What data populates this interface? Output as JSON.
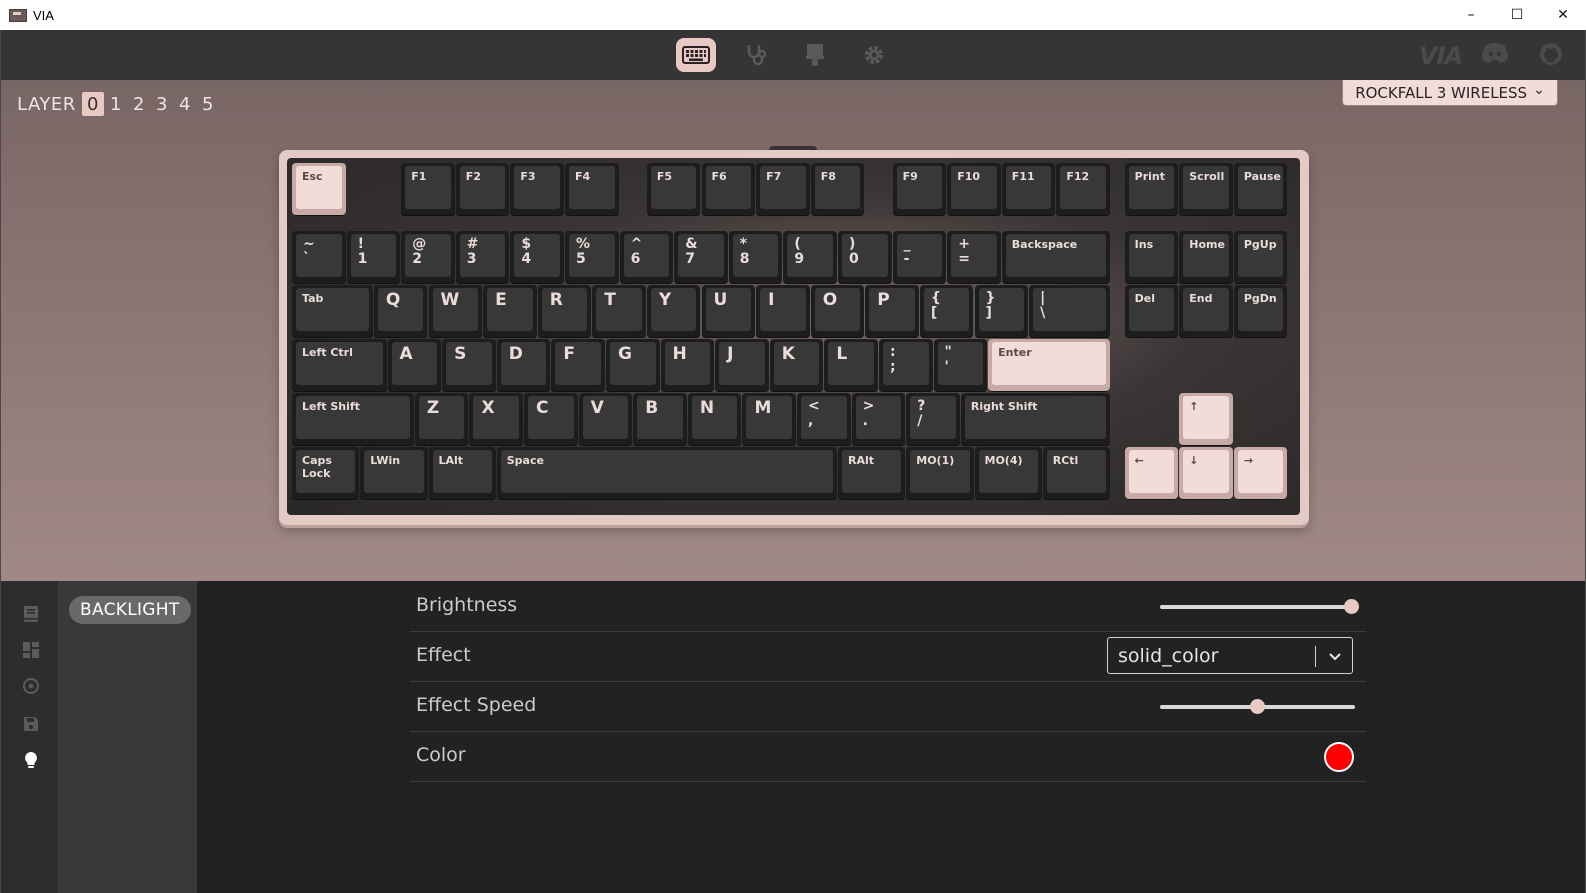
{
  "window": {
    "title": "VIA",
    "controls": [
      "–",
      "☐",
      "✕"
    ]
  },
  "nav": {
    "tabs": [
      {
        "id": "configure",
        "icon": "keyboard-icon",
        "active": true
      },
      {
        "id": "test",
        "icon": "stethoscope-icon",
        "active": false
      },
      {
        "id": "design",
        "icon": "brush-icon",
        "active": false
      },
      {
        "id": "settings",
        "icon": "gear-icon",
        "active": false
      }
    ],
    "right_icons": [
      "via-logo-icon",
      "discord-icon",
      "github-icon"
    ],
    "via_logo_text": "VIA"
  },
  "layers": {
    "label": "LAYER",
    "items": [
      "0",
      "1",
      "2",
      "3",
      "4",
      "5"
    ],
    "active": "0"
  },
  "device": {
    "name": "ROCKFALL 3 WIRELESS",
    "chevron": "⌄"
  },
  "keyboard": {
    "keys": [
      "Esc",
      "F1",
      "F2",
      "F3",
      "F4",
      "F5",
      "F6",
      "F7",
      "F8",
      "F9",
      "F10",
      "F11",
      "F12",
      "Print",
      "Scroll",
      "Pause",
      "~\n`",
      "!\n1",
      "@\n2",
      "#\n3",
      "$\n4",
      "%\n5",
      "^\n6",
      "&\n7",
      "*\n8",
      "(\n9",
      ")\n0",
      "_\n-",
      "+\n=",
      "Backspace",
      "Ins",
      "Home",
      "PgUp",
      "Tab",
      "Q",
      "W",
      "E",
      "R",
      "T",
      "Y",
      "U",
      "I",
      "O",
      "P",
      "{\n[",
      "}\n]",
      "|\n\\",
      "Del",
      "End",
      "PgDn",
      "Left Ctrl",
      "A",
      "S",
      "D",
      "F",
      "G",
      "H",
      "J",
      "K",
      "L",
      ":\n;",
      "\"\n'",
      "Enter",
      "Left Shift",
      "Z",
      "X",
      "C",
      "V",
      "B",
      "N",
      "M",
      "<\n,",
      ">\n.",
      "?\n/",
      "Right Shift",
      "↑",
      "Caps Lock",
      "LWin",
      "LAlt",
      "Space",
      "RAlt",
      "MO(1)",
      "MO(4)",
      "RCtl",
      "←",
      "↓",
      "→"
    ]
  },
  "sidebar": {
    "icons": [
      "book-icon",
      "layout-icon",
      "target-icon",
      "save-icon",
      "lightbulb-icon"
    ],
    "active": "lightbulb-icon"
  },
  "menu": {
    "active_item": "BACKLIGHT"
  },
  "backlight": {
    "brightness": {
      "label": "Brightness",
      "value_fraction": 1.0
    },
    "effect": {
      "label": "Effect",
      "value": "solid_color",
      "chevron": "⌄"
    },
    "effect_speed": {
      "label": "Effect Speed",
      "value_fraction": 0.5
    },
    "color": {
      "label": "Color",
      "value": "#ff0000"
    }
  },
  "colors": {
    "accent": "#e9c9c3",
    "nav_bg": "#363434",
    "panel_bg": "#222222",
    "key_dark": "#393838",
    "key_light": "#f2dcd8"
  }
}
